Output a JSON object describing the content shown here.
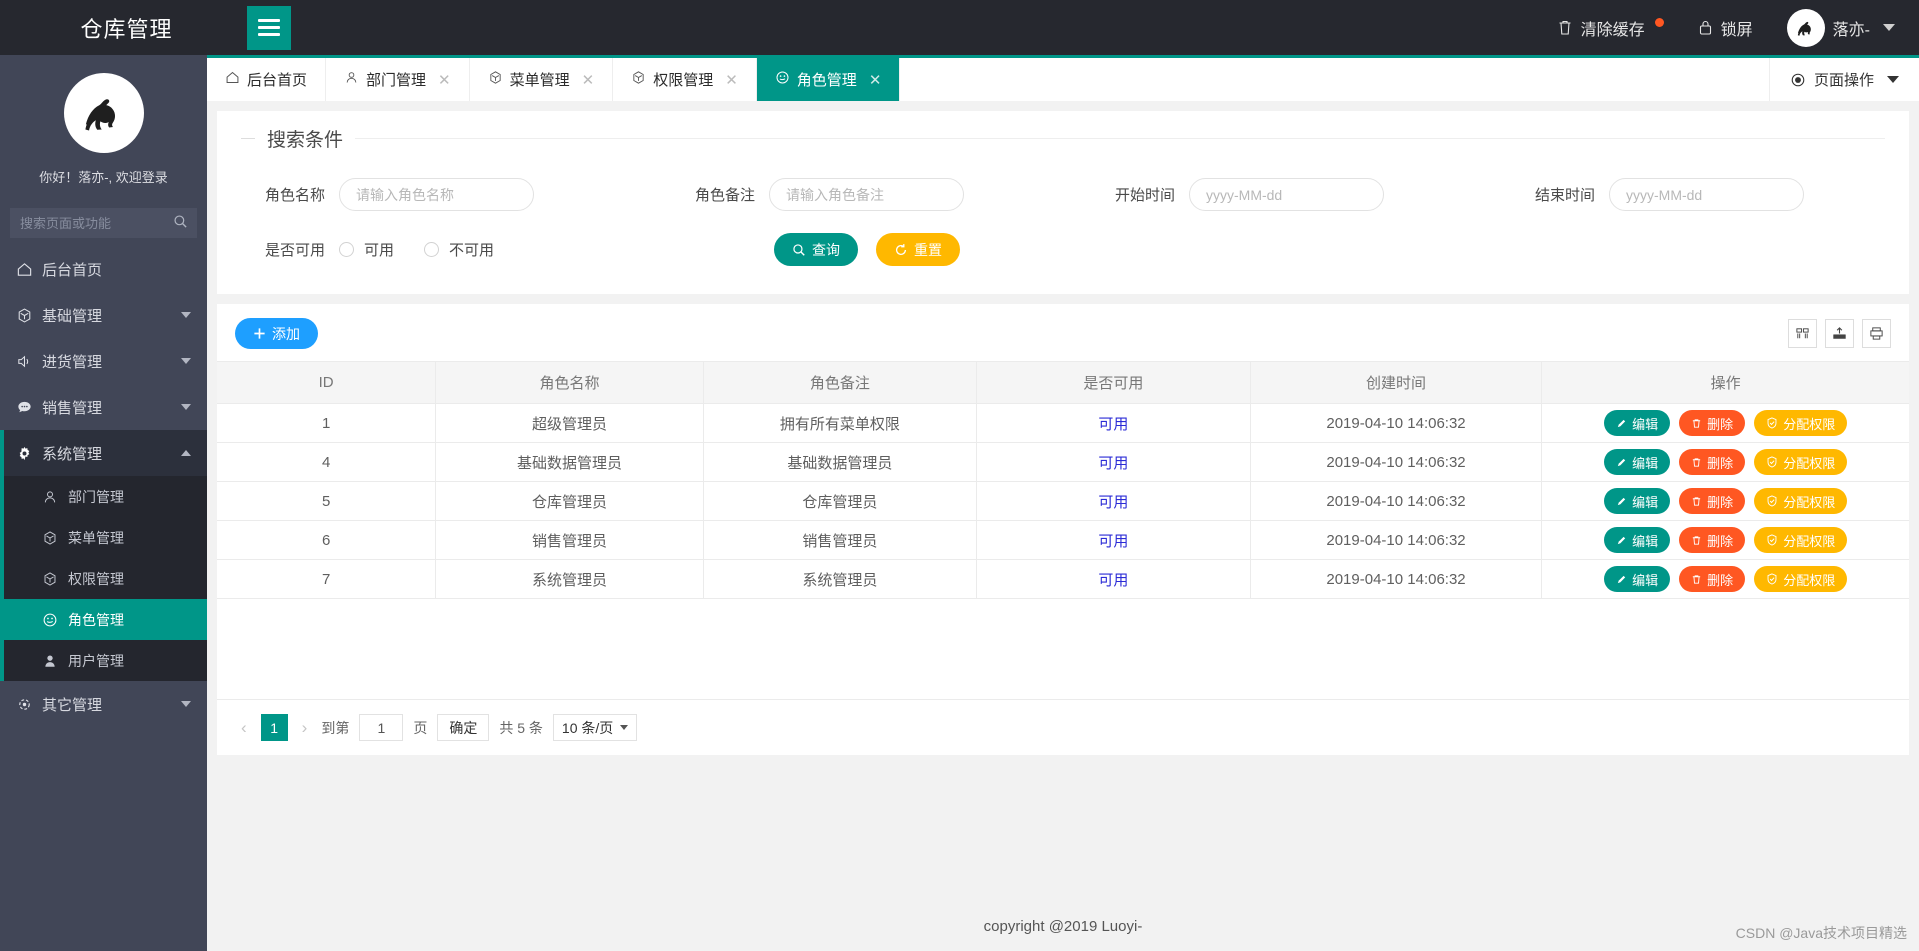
{
  "header": {
    "brand": "仓库管理",
    "hamburger_icon": "hamburger-icon",
    "clear_cache_label": "清除缓存",
    "clear_cache_icon": "trash-icon",
    "lock_screen_label": "锁屏",
    "lock_screen_icon": "lock-icon",
    "user_name": "落亦-",
    "avatar_icon": "horse-avatar-icon",
    "accent_color": "#009688",
    "badge_color": "#ff5722"
  },
  "sidebar": {
    "greeting": "你好！落亦-, 欢迎登录",
    "search_placeholder": "搜索页面或功能",
    "search_value": "",
    "search_icon": "search-icon",
    "items": [
      {
        "label": "后台首页",
        "icon": "home-icon",
        "has_arrow": false
      },
      {
        "label": "基础管理",
        "icon": "cube-icon",
        "has_arrow": true
      },
      {
        "label": "进货管理",
        "icon": "speaker-icon",
        "has_arrow": true
      },
      {
        "label": "销售管理",
        "icon": "chat-icon",
        "has_arrow": true
      },
      {
        "label": "系统管理",
        "icon": "gear-icon",
        "has_arrow": true,
        "expanded": true
      },
      {
        "label": "其它管理",
        "icon": "settings-icon",
        "has_arrow": true
      }
    ],
    "submenu": [
      {
        "label": "部门管理",
        "icon": "user-outline-icon",
        "active": false
      },
      {
        "label": "菜单管理",
        "icon": "cube-icon",
        "active": false
      },
      {
        "label": "权限管理",
        "icon": "cube-icon",
        "active": false
      },
      {
        "label": "角色管理",
        "icon": "smiley-icon",
        "active": true
      },
      {
        "label": "用户管理",
        "icon": "user-solid-icon",
        "active": false
      }
    ]
  },
  "tabbar": {
    "tabs": [
      {
        "label": "后台首页",
        "icon": "home-icon",
        "closable": false,
        "active": false
      },
      {
        "label": "部门管理",
        "icon": "user-outline-icon",
        "closable": true,
        "active": false
      },
      {
        "label": "菜单管理",
        "icon": "cube-icon",
        "closable": true,
        "active": false
      },
      {
        "label": "权限管理",
        "icon": "cube-icon",
        "closable": true,
        "active": false
      },
      {
        "label": "角色管理",
        "icon": "smiley-icon",
        "closable": true,
        "active": true
      }
    ],
    "close_glyph": "✕",
    "page_ops_label": "页面操作",
    "page_ops_icon": "radio-dot-icon"
  },
  "search_panel": {
    "legend": "搜索条件",
    "role_name_label": "角色名称",
    "role_name_placeholder": "请输入角色名称",
    "role_name_value": "",
    "role_remark_label": "角色备注",
    "role_remark_placeholder": "请输入角色备注",
    "role_remark_value": "",
    "start_time_label": "开始时间",
    "start_time_placeholder": "yyyy-MM-dd",
    "start_time_value": "",
    "end_time_label": "结束时间",
    "end_time_placeholder": "yyyy-MM-dd",
    "end_time_value": "",
    "available_label": "是否可用",
    "radio_yes": "可用",
    "radio_no": "不可用",
    "query_button": "查询",
    "query_icon": "search-icon",
    "reset_button": "重置",
    "reset_icon": "refresh-icon"
  },
  "table_toolbar": {
    "add_label": "添加",
    "add_icon": "plus-icon",
    "icons": [
      {
        "name": "columns-icon",
        "glyph": "▥"
      },
      {
        "name": "export-icon",
        "glyph": "⇪"
      },
      {
        "name": "print-icon",
        "glyph": "⎙"
      }
    ]
  },
  "table": {
    "columns": [
      "ID",
      "角色名称",
      "角色备注",
      "是否可用",
      "创建时间",
      "操作"
    ],
    "rows": [
      {
        "id": "1",
        "name": "超级管理员",
        "remark": "拥有所有菜单权限",
        "available": "可用",
        "created": "2019-04-10 14:06:32"
      },
      {
        "id": "4",
        "name": "基础数据管理员",
        "remark": "基础数据管理员",
        "available": "可用",
        "created": "2019-04-10 14:06:32"
      },
      {
        "id": "5",
        "name": "仓库管理员",
        "remark": "仓库管理员",
        "available": "可用",
        "created": "2019-04-10 14:06:32"
      },
      {
        "id": "6",
        "name": "销售管理员",
        "remark": "销售管理员",
        "available": "可用",
        "created": "2019-04-10 14:06:32"
      },
      {
        "id": "7",
        "name": "系统管理员",
        "remark": "系统管理员",
        "available": "可用",
        "created": "2019-04-10 14:06:32"
      }
    ],
    "actions": {
      "edit_label": "编辑",
      "edit_icon": "pencil-icon",
      "delete_label": "删除",
      "delete_icon": "trash-icon",
      "assign_label": "分配权限",
      "assign_icon": "shield-check-icon"
    }
  },
  "pagination": {
    "prev_glyph": "‹",
    "next_glyph": "›",
    "current_page": "1",
    "goto_prefix": "到第",
    "goto_value": "1",
    "goto_suffix": "页",
    "confirm_label": "确定",
    "total_label": "共 5 条",
    "page_size": "10 条/页"
  },
  "footer": {
    "copyright": "copyright @2019 Luoyi-",
    "watermark": "CSDN @Java技术项目精选"
  }
}
